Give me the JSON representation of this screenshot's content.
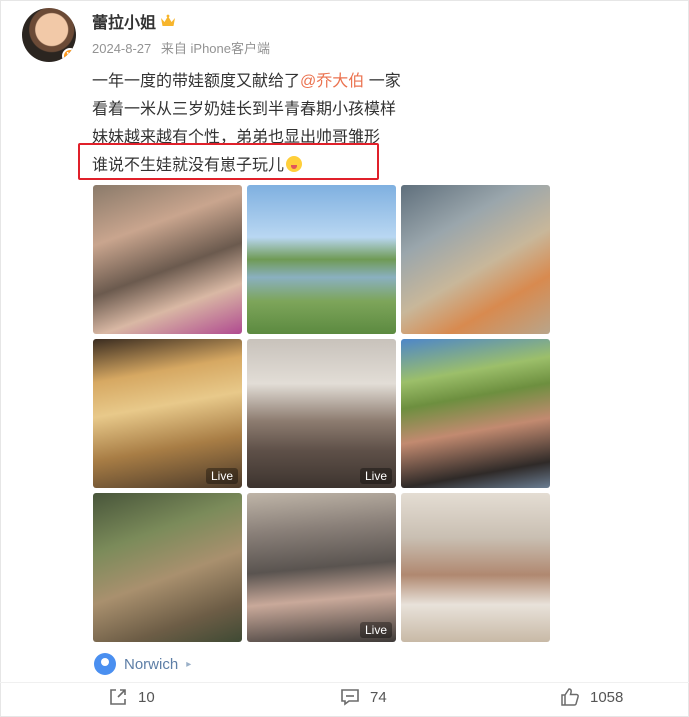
{
  "post": {
    "author": "蕾拉小姐",
    "date": "2024-8-27",
    "source": "来自 iPhone客户端",
    "text_lines": [
      {
        "before": "一年一度的带娃额度又献给了",
        "mention": "@乔大伯",
        "after": " 一家"
      },
      {
        "text": "看着一米从三岁奶娃长到半青春期小孩模样"
      },
      {
        "text": "妹妹越来越有个性，弟弟也显出帅哥雏形"
      },
      {
        "text": "谁说不生娃就没有崽子玩儿"
      }
    ],
    "photos": [
      {
        "live": ""
      },
      {
        "live": ""
      },
      {
        "live": ""
      },
      {
        "live": "Live"
      },
      {
        "live": "Live"
      },
      {
        "live": ""
      },
      {
        "live": ""
      },
      {
        "live": "Live"
      },
      {
        "live": ""
      }
    ],
    "location": "Norwich"
  },
  "actions": {
    "share_count": "10",
    "comment_count": "74",
    "like_count": "1058"
  },
  "colors": {
    "mention": "#eb7350",
    "highlight_border": "#e0202a",
    "location_text": "#5d7ea6"
  },
  "icons": [
    "verified-v-icon",
    "crown-icon",
    "location-pin-icon",
    "share-icon",
    "comment-icon",
    "like-icon",
    "emoji-tongue-icon"
  ]
}
